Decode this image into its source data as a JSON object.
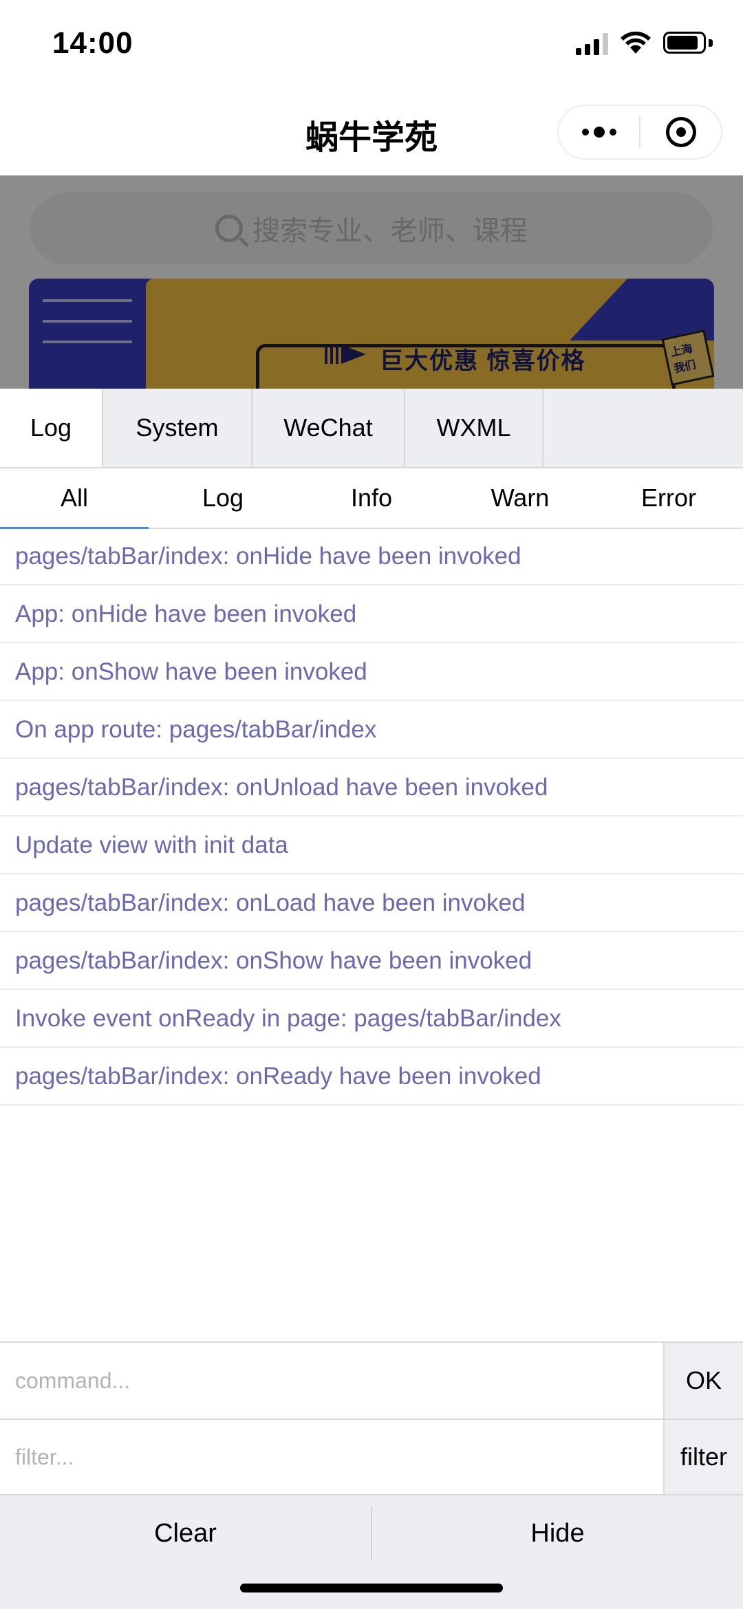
{
  "status_bar": {
    "time": "14:00"
  },
  "nav": {
    "title": "蜗牛学苑",
    "menu_icon": "more-dots-icon",
    "close_icon": "target-close-icon"
  },
  "page": {
    "search_placeholder": "搜索专业、老师、课程",
    "banner_text": "巨大优惠 惊喜价格",
    "banner_tag": "上海 我们"
  },
  "vconsole": {
    "tabs": [
      {
        "label": "Log",
        "active": true
      },
      {
        "label": "System",
        "active": false
      },
      {
        "label": "WeChat",
        "active": false
      },
      {
        "label": "WXML",
        "active": false
      }
    ],
    "subtabs": [
      {
        "label": "All",
        "active": true
      },
      {
        "label": "Log",
        "active": false
      },
      {
        "label": "Info",
        "active": false
      },
      {
        "label": "Warn",
        "active": false
      },
      {
        "label": "Error",
        "active": false
      }
    ],
    "logs": [
      "pages/tabBar/index: onHide have been invoked",
      "App: onHide have been invoked",
      "App: onShow have been invoked",
      "On app route: pages/tabBar/index",
      "pages/tabBar/index: onUnload have been invoked",
      "Update view with init data",
      "pages/tabBar/index: onLoad have been invoked",
      "pages/tabBar/index: onShow have been invoked",
      "Invoke event onReady in page: pages/tabBar/index",
      "pages/tabBar/index: onReady have been invoked"
    ],
    "command_placeholder": "command...",
    "ok_label": "OK",
    "filter_placeholder": "filter...",
    "filter_label": "filter",
    "clear_label": "Clear",
    "hide_label": "Hide",
    "log_color": "#6a68ae",
    "active_tab_underline": "#4a8bd6"
  }
}
